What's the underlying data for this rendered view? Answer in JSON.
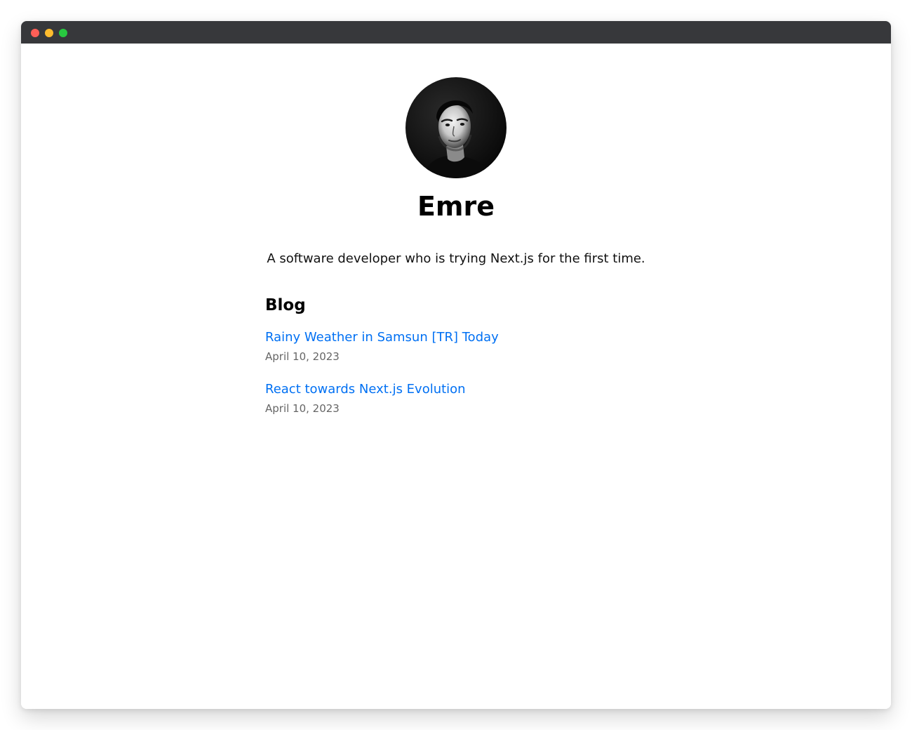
{
  "profile": {
    "name": "Emre",
    "bio": "A software developer who is trying Next.js for the first time."
  },
  "blog": {
    "heading": "Blog",
    "posts": [
      {
        "title": "Rainy Weather in Samsun [TR] Today",
        "date": "April 10, 2023"
      },
      {
        "title": "React towards Next.js Evolution",
        "date": "April 10, 2023"
      }
    ]
  },
  "colors": {
    "titlebar": "#37383b",
    "close": "#ff5f57",
    "minimize": "#febc2e",
    "maximize": "#28c840",
    "link": "#0070f3",
    "date": "#666666"
  },
  "icons": {
    "avatar": "profile-photo"
  }
}
